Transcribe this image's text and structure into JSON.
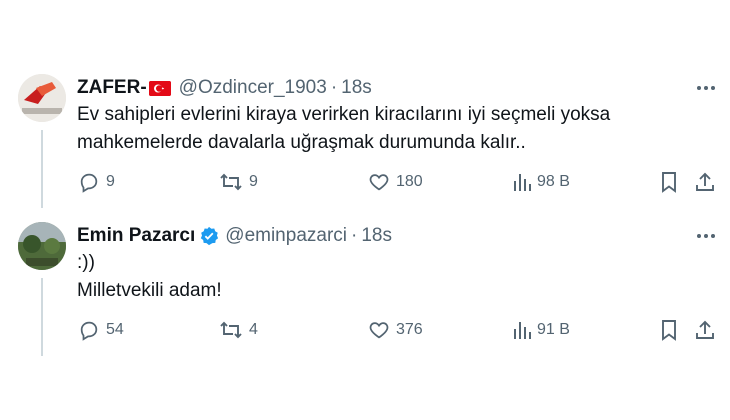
{
  "tweets": [
    {
      "name": "ZAFER-",
      "handle": "@Ozdincer_1903",
      "time": "18s",
      "lines": [
        "Ev sahipleri evlerini kiraya verirken kiracılarını iyi seçmeli yoksa",
        "mahkemelerde davalarla uğraşmak durumunda kalır.."
      ],
      "replies": "9",
      "retweets": "9",
      "likes": "180",
      "views": "98 B"
    },
    {
      "name": "Emin Pazarcı",
      "handle": "@eminpazarci",
      "time": "18s",
      "lines": [
        ":))",
        "Milletvekili adam!"
      ],
      "replies": "54",
      "retweets": "4",
      "likes": "376",
      "views": "91 B"
    }
  ],
  "separator": "·",
  "icons": {
    "reply": "reply-icon",
    "retweet": "retweet-icon",
    "like": "heart-icon",
    "views": "views-icon",
    "bookmark": "bookmark-icon",
    "share": "share-icon",
    "more": "more-icon",
    "flag": "turkey-flag-icon",
    "verified": "verified-badge-icon"
  },
  "colors": {
    "text": "#0f1419",
    "secondary": "#536471",
    "verified": "#1d9bf0",
    "flag": "#e30a17"
  }
}
